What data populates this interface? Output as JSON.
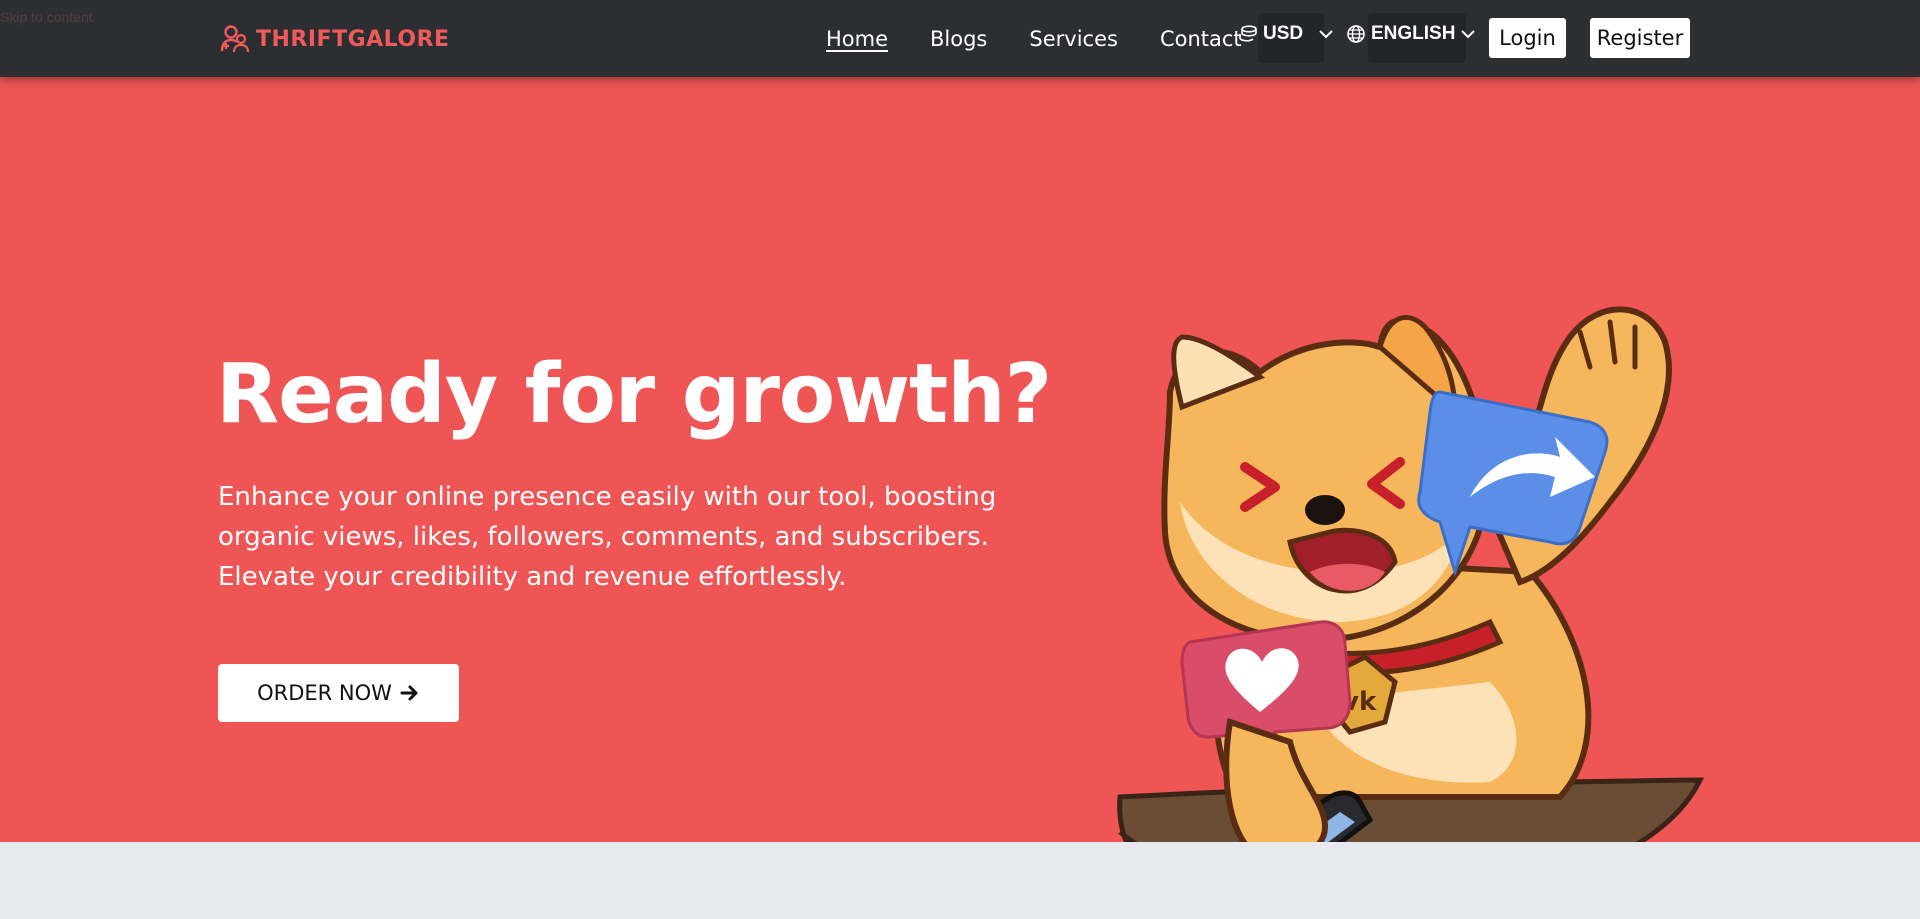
{
  "skip_link": "Skip to content",
  "brand": {
    "name": "THRIFTGALORE",
    "color": "#f05a5b",
    "icon": "users-icon"
  },
  "nav": {
    "links": [
      "Home",
      "Blogs",
      "Services",
      "Contact"
    ],
    "active": "Home",
    "currency": {
      "label": "USD",
      "icon": "coins-icon"
    },
    "language": {
      "label": "ENGLISH",
      "icon": "globe-icon"
    },
    "login_label": "Login",
    "register_label": "Register"
  },
  "hero": {
    "title": "Ready for growth?",
    "subtitle": "Enhance your online presence easily with our tool, boosting organic views, likes, followers, comments, and subscribers. Elevate your credibility and revenue effortlessly.",
    "cta_label": "ORDER NOW",
    "cta_icon": "arrow-right-icon",
    "background": "#ef5555",
    "illustration": "shiba-inu-mascot-with-share-and-like-bubbles"
  },
  "colors": {
    "navbar": "#2c2e31",
    "hero": "#ef5555",
    "page": "#e8e9ec"
  }
}
